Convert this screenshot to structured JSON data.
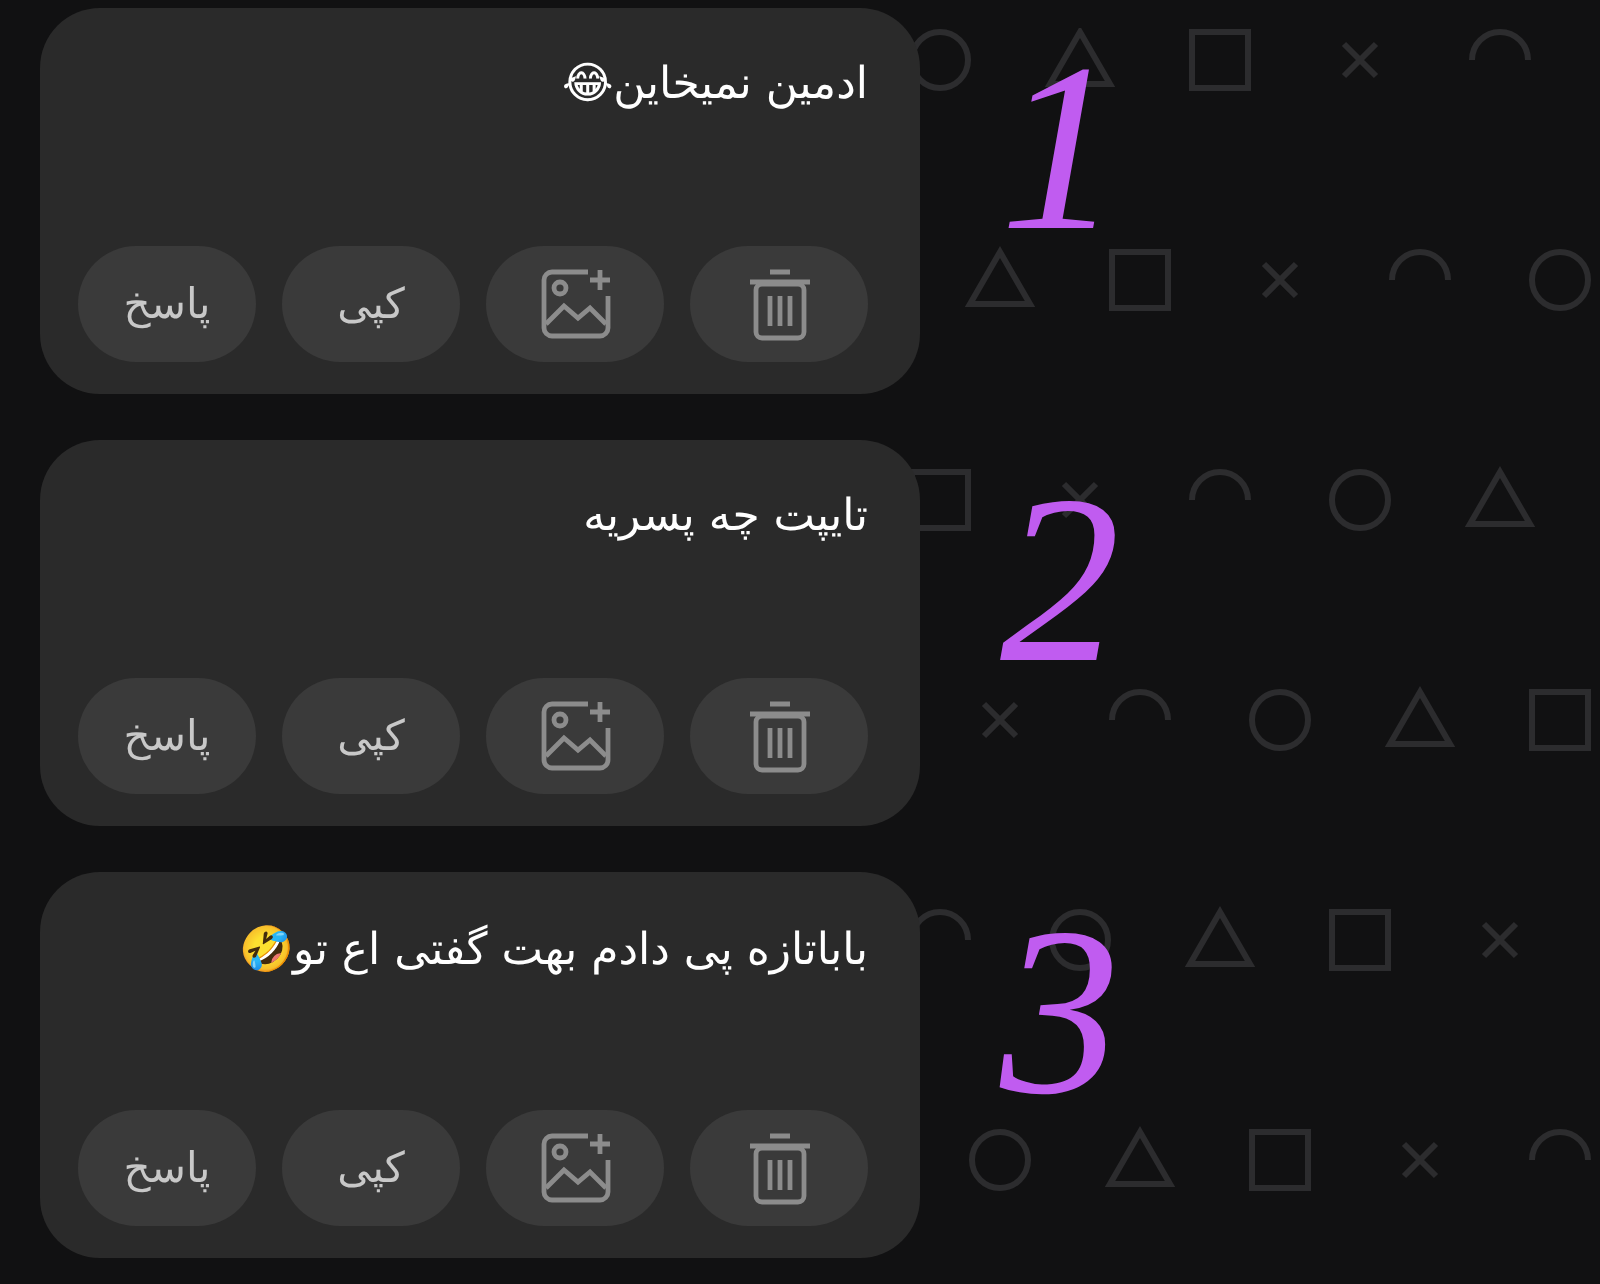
{
  "messages": [
    {
      "text": "ادمین نمیخاین😂",
      "annotation": "1",
      "actions": [
        {
          "kind": "delete"
        },
        {
          "kind": "image"
        },
        {
          "kind": "copy",
          "label": "کپی"
        },
        {
          "kind": "reply",
          "label": "پاسخ"
        }
      ]
    },
    {
      "text": "تایپت چه پسریه",
      "annotation": "2",
      "actions": [
        {
          "kind": "delete"
        },
        {
          "kind": "image"
        },
        {
          "kind": "copy",
          "label": "کپی"
        },
        {
          "kind": "reply",
          "label": "پاسخ"
        }
      ]
    },
    {
      "text": "باباتازه پی دادم بهت گفتی اع تو🤣",
      "annotation": "3",
      "actions": [
        {
          "kind": "delete"
        },
        {
          "kind": "image"
        },
        {
          "kind": "copy",
          "label": "کپی"
        },
        {
          "kind": "reply",
          "label": "پاسخ"
        }
      ]
    }
  ]
}
